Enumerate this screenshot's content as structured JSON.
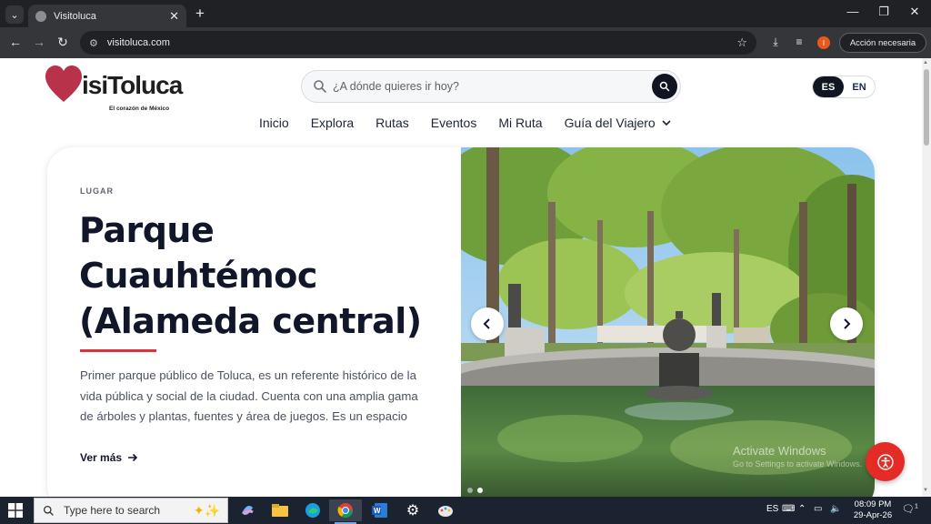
{
  "browser": {
    "tab_title": "Visitoluca",
    "url": "visitoluca.com",
    "action_button": "Acción necesaria",
    "profile_initial": "I"
  },
  "site": {
    "logo_tagline": "El corazón de México",
    "logo_word": "isiToluca",
    "search_placeholder": "¿A dónde quieres ir hoy?",
    "lang_es": "ES",
    "lang_en": "EN",
    "nav": {
      "inicio": "Inicio",
      "explora": "Explora",
      "rutas": "Rutas",
      "eventos": "Eventos",
      "mi_ruta": "Mi Ruta",
      "guia": "Guía del Viajero"
    }
  },
  "hero": {
    "eyebrow": "LUGAR",
    "title_line1": "Parque",
    "title_line2": "Cuauhtémoc",
    "title_line3": "(Alameda central)",
    "description": "Primer parque público de Toluca, es un referente histórico de la vida pública y social de la ciudad. Cuenta con una amplia gama de árboles y plantas, fuentes y área de juegos. Es un espacio ideal para pasear y convivir en familia.",
    "cta": "Ver más",
    "slide_count": 2,
    "active_slide": 1
  },
  "os": {
    "watermark_title": "Activate Windows",
    "watermark_sub": "Go to Settings to activate Windows.",
    "taskbar_search": "Type here to search",
    "tray_lang": "ES",
    "time": "08:09 PM",
    "date": "29-Apr-26",
    "notifications": "1"
  },
  "colors": {
    "brand_red": "#d8343a",
    "dark_navy": "#111522",
    "logo_heart": "#b8324a"
  }
}
